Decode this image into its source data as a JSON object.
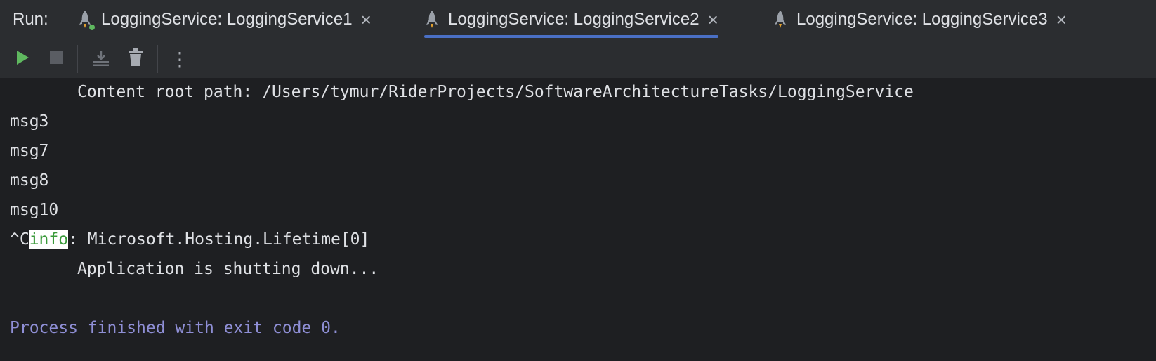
{
  "run_label": "Run:",
  "tabs": [
    {
      "label": "LoggingService: LoggingService1",
      "icon": "rocket-icon",
      "running": true,
      "active": false
    },
    {
      "label": "LoggingService: LoggingService2",
      "icon": "rocket-icon",
      "running": false,
      "active": true
    },
    {
      "label": "LoggingService: LoggingService3",
      "icon": "rocket-icon",
      "running": false,
      "active": false
    }
  ],
  "tab_close_glyph": "×",
  "toolbar": {
    "buttons": [
      "rerun-icon",
      "stop-icon",
      "scroll-to-end-icon",
      "clear-icon",
      "more-icon"
    ],
    "more_glyph": "⋮"
  },
  "console": {
    "content_root_line": "Content root path: /Users/tymur/RiderProjects/SoftwareArchitectureTasks/LoggingService",
    "messages": [
      "msg3",
      "msg7",
      "msg8",
      "msg10"
    ],
    "interrupt_prefix": "^C",
    "info_word": "info",
    "info_rest": ": Microsoft.Hosting.Lifetime[0]",
    "shutdown_line": "Application is shutting down...",
    "process_line": "Process finished with exit code 0."
  },
  "colors": {
    "background": "#1e1f22",
    "panel": "#2b2d30",
    "text": "#dfe1e5",
    "accent": "#4a6fc4",
    "run_green": "#5fb85f",
    "process_text": "#8f8fd6"
  }
}
